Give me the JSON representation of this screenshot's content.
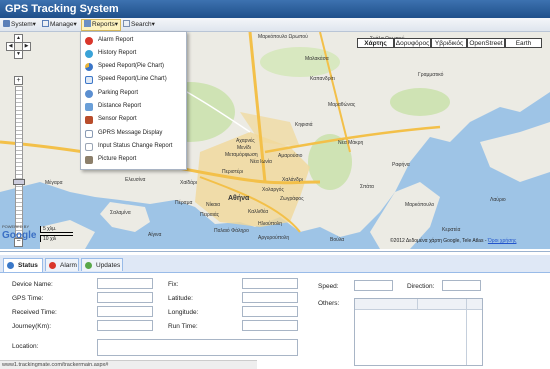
{
  "app": {
    "title": "GPS Tracking System"
  },
  "menubar": {
    "items": [
      {
        "label": "System▾"
      },
      {
        "label": "Manage▾"
      },
      {
        "label": "Reports▾"
      },
      {
        "label": "Search▾"
      }
    ]
  },
  "reports_menu": {
    "items": [
      {
        "label": "Alarm Report",
        "icon": "alarm-icon",
        "color": "#d9362b"
      },
      {
        "label": "History Report",
        "icon": "history-icon",
        "color": "#3aa3d8"
      },
      {
        "label": "Speed Report(Pie Chart)",
        "icon": "pie-chart-icon",
        "color": "#3b76c8"
      },
      {
        "label": "Speed Report(Line Chart)",
        "icon": "line-chart-icon",
        "color": "#3b76c8"
      },
      {
        "label": "Parking Report",
        "icon": "parking-icon",
        "color": "#5b8fd1"
      },
      {
        "label": "Distance Report",
        "icon": "distance-icon",
        "color": "#6a9fd8"
      },
      {
        "label": "Sensor Report",
        "icon": "sensor-icon",
        "color": "#b84c2b"
      },
      {
        "label": "GPRS Message Display",
        "icon": "message-icon",
        "color": "#8a9bb4"
      },
      {
        "label": "Input Status Change Report",
        "icon": "input-status-icon",
        "color": "#9aa5b5"
      },
      {
        "label": "Picture Report",
        "icon": "picture-icon",
        "color": "#8c7f6a"
      }
    ]
  },
  "map": {
    "types": [
      "Χάρτης",
      "Δορυφόρος",
      "Υβριδικός",
      "OpenStreet",
      "Earth"
    ],
    "selected_type": "Χάρτης",
    "places": [
      "Μαρκόπουλο Ωρωπού",
      "Σκάλα Ωρωπού",
      "Μαλακάσα",
      "Καπανδρίτι",
      "Γραμματικό",
      "Μαραθώνας",
      "Νέα Μάκρη",
      "Αχαρνές",
      "Κηφισιά",
      "Μενίδι",
      "Μεταμόρφωση",
      "Νέα Ιωνία",
      "Αμαρούσιο",
      "Ραφήνα",
      "Περιστέρι",
      "Χαλάνδρι",
      "Χολαργός",
      "Αθήνα",
      "Ζωγράφος",
      "Χαϊδάρι",
      "Νίκαια",
      "Καλλιθέα",
      "Πειραιάς",
      "Ηλιούπολη",
      "Παλαιό Φάληρο",
      "Αργυρούπολη",
      "Βούλα",
      "Κερατέα",
      "Ελευσίνα",
      "Μέγαρα",
      "Σαλαμίνα",
      "Πέραμα",
      "Σπάτα",
      "Αίγινα",
      "Λαύριο",
      "Μαρκόπουλο"
    ],
    "scale_km": "5 χλμ.",
    "scale_mi": "10 χιλ",
    "attribution": "©2012 Δεδομένα χάρτη Google, Tele Atlas -",
    "terms": "Όροι χρήσης",
    "powered_by": "POWERED BY",
    "logo": "Google"
  },
  "bottom_panel": {
    "tabs": [
      {
        "label": "Status",
        "icon": "status-icon"
      },
      {
        "label": "Alarm",
        "icon": "alarm-tab-icon"
      },
      {
        "label": "Updates",
        "icon": "updates-icon"
      }
    ],
    "fields": {
      "device_name": {
        "label": "Device Name:",
        "value": ""
      },
      "gps_time": {
        "label": "GPS Time:",
        "value": ""
      },
      "received_time": {
        "label": "Received Time:",
        "value": ""
      },
      "journey": {
        "label": "Journey(Km):",
        "value": ""
      },
      "location": {
        "label": "Location:",
        "value": ""
      },
      "fix": {
        "label": "Fix:",
        "value": ""
      },
      "latitude": {
        "label": "Latitude:",
        "value": ""
      },
      "longitude": {
        "label": "Longitude:",
        "value": ""
      },
      "run_time": {
        "label": "Run Time:",
        "value": ""
      },
      "speed": {
        "label": "Speed:",
        "value": ""
      },
      "direction": {
        "label": "Direction:",
        "value": ""
      },
      "others": {
        "label": "Others:"
      }
    }
  },
  "statusbar": {
    "url": "www1.trackingmate.com/trackermain.aspx#"
  }
}
